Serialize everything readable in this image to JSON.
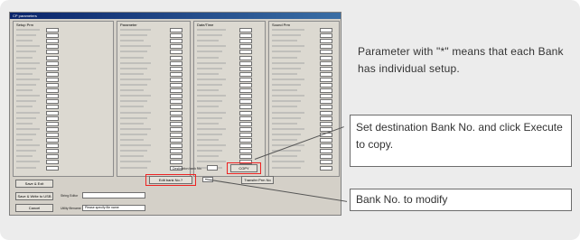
{
  "window": {
    "title": "CP parameters"
  },
  "columns": [
    {
      "key": "setup",
      "header": "Setup Prm"
    },
    {
      "key": "param",
      "header": "Parameter"
    },
    {
      "key": "datetime",
      "header": "Date/Time"
    },
    {
      "key": "sound",
      "header": "Sound Prm"
    }
  ],
  "buttons": {
    "save_exit": "Save & Exit",
    "save_write_usb": "Save & Write to USB",
    "cancel": "Cancel",
    "copy": "COPY",
    "execute": "Edit bank No.?",
    "transfer": "Transfer Prm No"
  },
  "fields": {
    "destination_bank_label": "Destination bank No.",
    "string_editor_label": "String Editor",
    "utility_filename_label": "Utility filename",
    "utility_filename_value": "Please specify file name"
  },
  "annotations": {
    "note": "Parameter with \"*\" means that each Bank has individual setup.",
    "copy_instruction": "Set destination Bank No. and click Execute to copy.",
    "modify_bank": "Bank No. to modify"
  }
}
